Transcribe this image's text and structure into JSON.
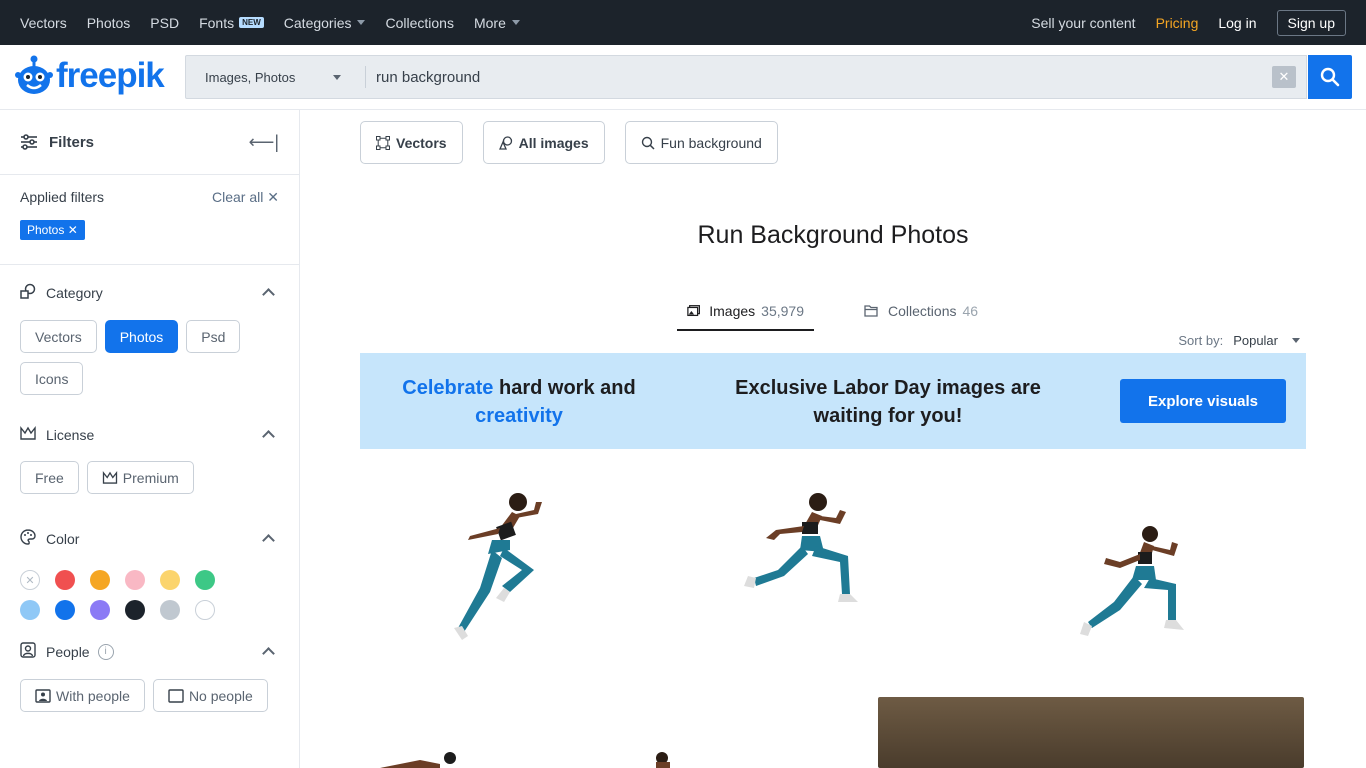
{
  "topnav": {
    "left": [
      {
        "label": "Vectors"
      },
      {
        "label": "Photos"
      },
      {
        "label": "PSD"
      },
      {
        "label": "Fonts",
        "badge": "NEW"
      },
      {
        "label": "Categories",
        "dropdown": true
      },
      {
        "label": "Collections"
      },
      {
        "label": "More",
        "dropdown": true
      }
    ],
    "sell": "Sell your content",
    "pricing": "Pricing",
    "login": "Log in",
    "signup": "Sign up"
  },
  "header": {
    "logo_text": "freepik",
    "search_type": "Images, Photos",
    "search_value": "run background",
    "clear_icon": "close-icon",
    "search_icon": "search-icon"
  },
  "sidebar": {
    "title": "Filters",
    "applied_label": "Applied filters",
    "clear_all": "Clear all",
    "applied_chip": "Photos",
    "category": {
      "title": "Category",
      "options": [
        "Vectors",
        "Photos",
        "Psd",
        "Icons"
      ],
      "active": "Photos"
    },
    "license": {
      "title": "License",
      "options": [
        "Free",
        "Premium"
      ]
    },
    "color": {
      "title": "Color",
      "swatches": [
        "#ffffff",
        "#f05050",
        "#f5a623",
        "#f9b8c4",
        "#fbd46d",
        "#3dc886",
        "#8fc8f6",
        "#1273eb",
        "#8b7af5",
        "#1c232b",
        "#c0c8d0",
        "#ffffff"
      ]
    },
    "people": {
      "title": "People",
      "options": [
        "With people",
        "No people"
      ]
    }
  },
  "main": {
    "related": [
      {
        "label": "Vectors",
        "icon": "vector-icon",
        "bold": true
      },
      {
        "label": "All images",
        "icon": "images-icon",
        "bold": true
      },
      {
        "label": "Fun background",
        "icon": "search-icon",
        "bold": false
      }
    ],
    "title": "Run Background Photos",
    "tabs": [
      {
        "label": "Images",
        "count": "35,979",
        "icon": "image-icon",
        "active": true
      },
      {
        "label": "Collections",
        "count": "46",
        "icon": "folder-icon",
        "active": false
      }
    ],
    "sort_label": "Sort by:",
    "sort_value": "Popular",
    "banner": {
      "left_hl1": "Celebrate",
      "left_mid": "hard work and",
      "left_hl2": "creativity",
      "middle": "Exclusive Labor Day images are waiting for you!",
      "button": "Explore visuals"
    }
  }
}
